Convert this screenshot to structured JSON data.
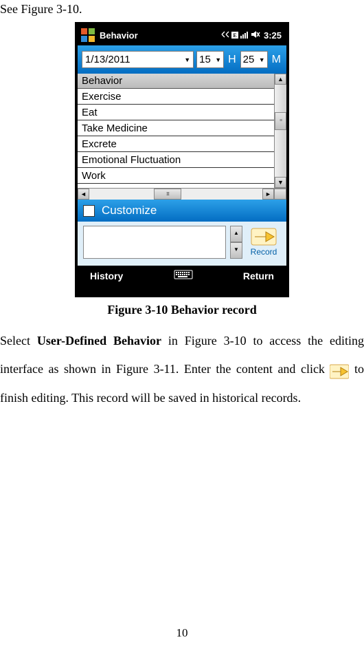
{
  "doc": {
    "intro": "See Figure 3-10.",
    "caption": "Figure 3-10 Behavior record",
    "p1a": "Select ",
    "p1b": "User-Defined Behavior",
    "p1c": " in Figure 3-10 to access the editing interface as shown in Figure 3-11. Enter the content and click ",
    "p1d": " to finish editing. This record will be saved in historical records.",
    "page_number": "10"
  },
  "screen": {
    "taskbar": {
      "title": "Behavior",
      "time": "3:25"
    },
    "date": {
      "value": "1/13/2011"
    },
    "hour": {
      "value": "15",
      "label": "H"
    },
    "minute": {
      "value": "25",
      "label": "M"
    },
    "list": {
      "header": "Behavior",
      "items": [
        "Exercise",
        "Eat",
        "Take Medicine",
        "Excrete",
        "Emotional Fluctuation",
        "Work"
      ]
    },
    "customize": {
      "label": "Customize"
    },
    "record": {
      "label": "Record"
    },
    "bottombar": {
      "left": "History",
      "right": "Return"
    }
  }
}
